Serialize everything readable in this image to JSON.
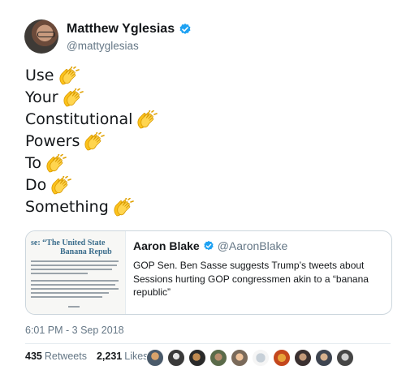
{
  "author": {
    "display_name": "Matthew Yglesias",
    "handle": "@mattyglesias",
    "verified": true
  },
  "tweet": {
    "lines": [
      "Use",
      "Your",
      "Constitutional",
      "Powers",
      "To",
      "Do",
      "Something"
    ],
    "emoji_icon": "clapping-hands-icon"
  },
  "quoted_tweet": {
    "thumbnail": {
      "headline_line1": "se: “The United State",
      "headline_line2": "Banana Repub"
    },
    "author_name": "Aaron Blake",
    "author_handle": "@AaronBlake",
    "verified": true,
    "text": "GOP Sen. Ben Sasse suggests Trump’s tweets about Sessions hurting GOP congressmen akin to a “banana republic”"
  },
  "timestamp": "6:01 PM - 3 Sep 2018",
  "stats": {
    "retweets_count": "435",
    "retweets_label": "Retweets",
    "likes_count": "2,231",
    "likes_label": "Likes"
  },
  "colors": {
    "verified_blue": "#1da1f2",
    "secondary_text": "#657786",
    "clap_yellow": "#fcc21b"
  }
}
